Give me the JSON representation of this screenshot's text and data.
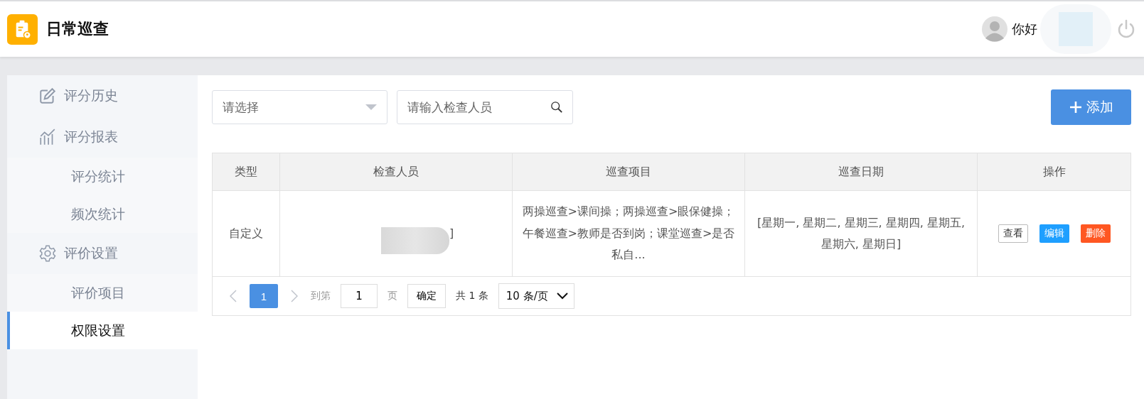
{
  "header": {
    "title": "日常巡查",
    "greeting": "你好"
  },
  "sidebar": {
    "items": [
      {
        "label": "评分历史",
        "kind": "edit",
        "selected": false
      },
      {
        "label": "评分报表",
        "kind": "chart",
        "selected": false,
        "children": [
          {
            "label": "评分统计",
            "selected": false
          },
          {
            "label": "频次统计",
            "selected": false
          }
        ]
      },
      {
        "label": "评价设置",
        "kind": "gear",
        "selected": false,
        "children": [
          {
            "label": "评价项目",
            "selected": false
          },
          {
            "label": "权限设置",
            "selected": true
          }
        ]
      }
    ]
  },
  "filters": {
    "type_select": {
      "placeholder": "请选择"
    },
    "inspector_search": {
      "placeholder": "请输入检查人员"
    },
    "add_button": "添加"
  },
  "table": {
    "columns": [
      "类型",
      "检查人员",
      "巡查项目",
      "巡查日期",
      "操作"
    ],
    "rows": [
      {
        "type": "自定义",
        "inspector": "]",
        "items": "两操巡查>课间操；两操巡查>眼保健操；午餐巡查>教师是否到岗；课堂巡查>是否私自...",
        "dates": "[星期一, 星期二, 星期三, 星期四, 星期五, 星期六, 星期日]",
        "actions": [
          {
            "label": "查看",
            "kind": "view"
          },
          {
            "label": "编辑",
            "kind": "edit"
          },
          {
            "label": "删除",
            "kind": "delete"
          }
        ]
      }
    ]
  },
  "pagination": {
    "pages": [
      {
        "label": "1",
        "selected": true
      }
    ],
    "goto_label": "到第",
    "goto_value": "1",
    "page_unit": "页",
    "confirm": "确定",
    "total": "共 1 条",
    "page_size": "10 条/页"
  }
}
